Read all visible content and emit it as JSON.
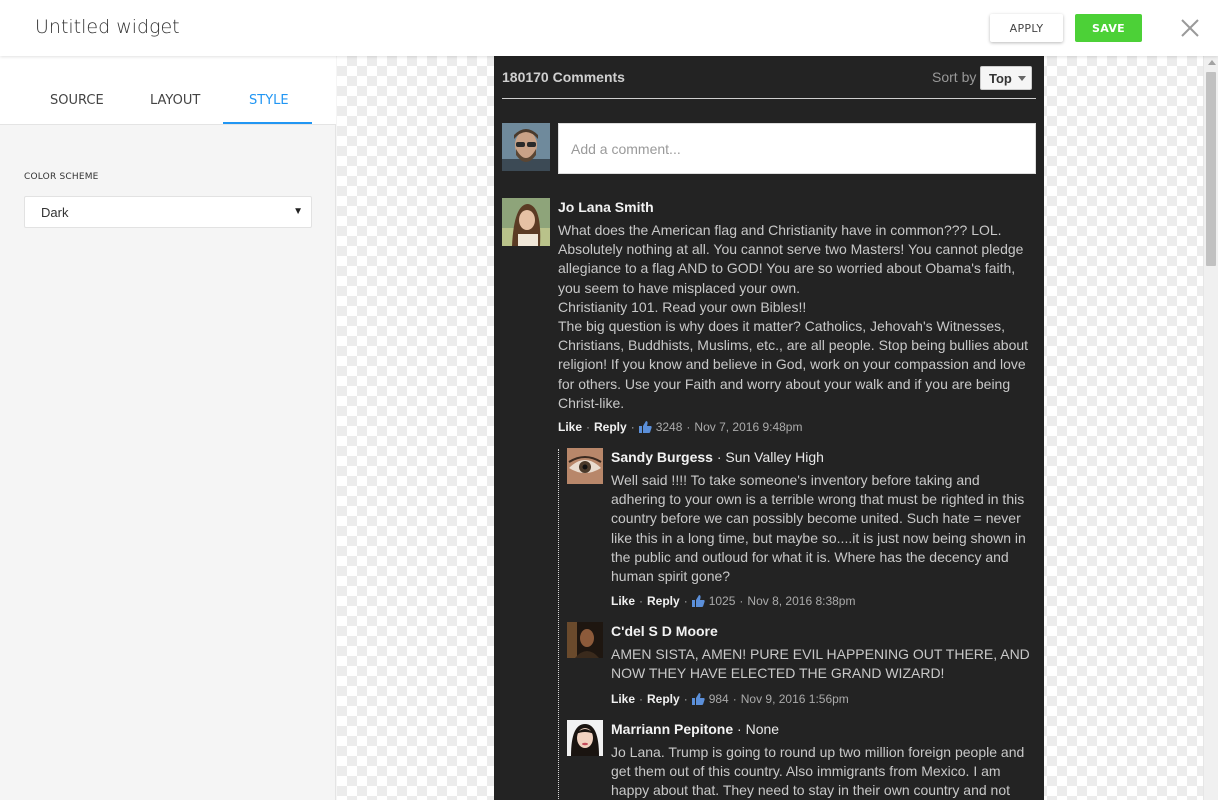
{
  "header": {
    "title": "Untitled widget",
    "apply_label": "APPLY",
    "save_label": "SAVE",
    "save_color": "#4cd137"
  },
  "tabs": [
    {
      "label": "SOURCE",
      "active": false
    },
    {
      "label": "LAYOUT",
      "active": false
    },
    {
      "label": "STYLE",
      "active": true
    }
  ],
  "style_panel": {
    "color_scheme_label": "COLOR SCHEME",
    "color_scheme_value": "Dark"
  },
  "widget": {
    "comment_count": "180170 Comments",
    "sort_label": "Sort by",
    "sort_value": "Top",
    "comment_placeholder": "Add a comment...",
    "comments": [
      {
        "name": "Jo Lana Smith",
        "affiliation": "",
        "body": "What does the American flag and Christianity have in common??? LOL.\nAbsolutely nothing at all. You cannot serve two Masters! You cannot pledge\nallegiance to a flag AND to GOD! You are so worried about Obama's faith,\nyou seem to have misplaced your own.\nChristianity 101. Read your own Bibles!!\nThe big question is why does it matter? Catholics, Jehovah's Witnesses,\nChristians, Buddhists, Muslims, etc., are all people. Stop being bullies about\nreligion! If you know and believe in God, work on your compassion and love\nfor others. Use your Faith and worry about your walk and if you are being\nChrist-like.",
        "like_label": "Like",
        "reply_label": "Reply",
        "likes": "3248",
        "date": "Nov 7, 2016 9:48pm"
      },
      {
        "name": "Sandy Burgess",
        "affiliation": "· Sun Valley High",
        "body": "Well said !!!! To take someone's inventory before taking and\nadhering to your own is a terrible wrong that must be righted in this\ncountry before we can possibly become united. Such hate = never\nlike this in a long time, but maybe so....it is just now being shown in\nthe public and outloud for what it is. Where has the decency and\nhuman spirit gone?",
        "like_label": "Like",
        "reply_label": "Reply",
        "likes": "1025",
        "date": "Nov 8, 2016 8:38pm"
      },
      {
        "name": "C'del S D Moore",
        "affiliation": "",
        "body": "AMEN SISTA, AMEN! PURE EVIL HAPPENING OUT THERE, AND\nNOW THEY HAVE ELECTED THE GRAND WIZARD!",
        "like_label": "Like",
        "reply_label": "Reply",
        "likes": "984",
        "date": "Nov 9, 2016 1:56pm"
      },
      {
        "name": "Marriann Pepitone",
        "affiliation": "· None",
        "body": "Jo Lana. Trump is going to round up two million foreign people and\nget them out of this country. Also immigrants from Mexico. I am\nhappy about that. They need to stay in their own country and not",
        "like_label": "",
        "reply_label": "",
        "likes": "",
        "date": ""
      }
    ]
  },
  "colors": {
    "accent_blue": "#2196f3",
    "widget_bg": "#232323",
    "like_icon": "#5b8fd9"
  }
}
